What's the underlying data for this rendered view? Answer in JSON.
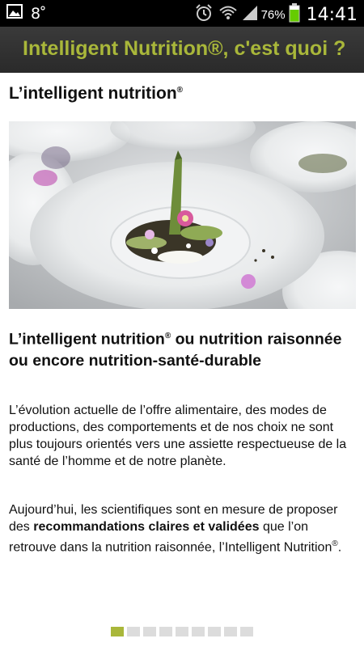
{
  "status_bar": {
    "notification": "8",
    "battery_percent": "76%",
    "time": "14:41",
    "icons": [
      "gallery-icon",
      "alarm-icon",
      "wifi-icon",
      "signal-icon",
      "battery-icon"
    ]
  },
  "title_bar": {
    "title": "Intelligent Nutrition®, c'est quoi ?",
    "accent_color": "#a9b73a"
  },
  "article": {
    "heading": "L’intelligent nutrition",
    "heading_mark": "®",
    "hero_image": "plated-dish-photo",
    "subheading_part1": "L’intelligent nutrition",
    "subheading_mark": "®",
    "subheading_part2": " ou nutrition raisonnée ou encore nutrition-santé-durable",
    "paragraph1": "L’évolution actuelle de l’offre alimentaire, des modes de productions, des comportements et de nos choix ne sont plus toujours orientés vers une assiette respectueuse de la santé de l’homme et de notre planète.",
    "paragraph2_before": "Aujourd’hui, les scientifiques sont en mesure de proposer des ",
    "paragraph2_bold": "recommandations claires et validées",
    "paragraph2_after": " que l’on retrouve dans la nutrition raisonnée, l’Intelligent Nutrition",
    "paragraph2_mark": "®",
    "paragraph2_end": "."
  },
  "pager": {
    "total_pages": 9,
    "current_page": 1
  }
}
